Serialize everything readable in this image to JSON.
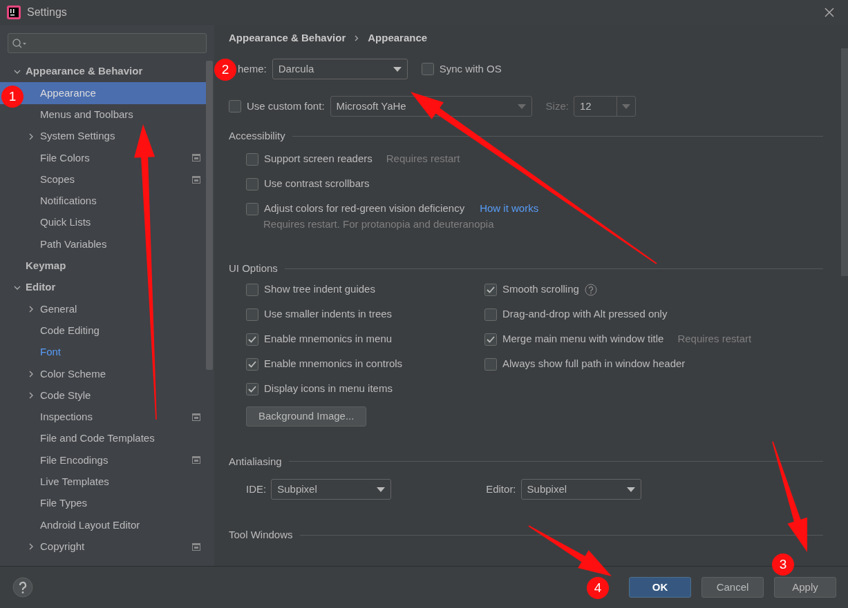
{
  "window": {
    "title": "Settings"
  },
  "sidebar": {
    "items": [
      {
        "label": "Appearance & Behavior",
        "selected": false,
        "expanded": true,
        "children": [
          {
            "label": "Appearance",
            "selected": true,
            "modified": false,
            "project_icon": false
          },
          {
            "label": "Menus and Toolbars",
            "selected": false,
            "modified": false,
            "project_icon": false
          },
          {
            "label": "System Settings",
            "selected": false,
            "modified": false,
            "project_icon": false,
            "expanded": false
          },
          {
            "label": "File Colors",
            "selected": false,
            "modified": false,
            "project_icon": true
          },
          {
            "label": "Scopes",
            "selected": false,
            "modified": false,
            "project_icon": true
          },
          {
            "label": "Notifications",
            "selected": false,
            "modified": false,
            "project_icon": false
          },
          {
            "label": "Quick Lists",
            "selected": false,
            "modified": false,
            "project_icon": false
          },
          {
            "label": "Path Variables",
            "selected": false,
            "modified": false,
            "project_icon": false
          }
        ]
      },
      {
        "label": "Keymap",
        "selected": false
      },
      {
        "label": "Editor",
        "selected": false,
        "expanded": true,
        "children": [
          {
            "label": "General",
            "selected": false,
            "modified": false,
            "project_icon": false,
            "expanded": false
          },
          {
            "label": "Code Editing",
            "selected": false,
            "modified": false,
            "project_icon": false
          },
          {
            "label": "Font",
            "selected": false,
            "modified": true,
            "project_icon": false
          },
          {
            "label": "Color Scheme",
            "selected": false,
            "modified": false,
            "project_icon": false,
            "expanded": false
          },
          {
            "label": "Code Style",
            "selected": false,
            "modified": false,
            "project_icon": false,
            "expanded": false
          },
          {
            "label": "Inspections",
            "selected": false,
            "modified": false,
            "project_icon": true
          },
          {
            "label": "File and Code Templates",
            "selected": false,
            "modified": false,
            "project_icon": false
          },
          {
            "label": "File Encodings",
            "selected": false,
            "modified": false,
            "project_icon": true
          },
          {
            "label": "Live Templates",
            "selected": false,
            "modified": false,
            "project_icon": false
          },
          {
            "label": "File Types",
            "selected": false,
            "modified": false,
            "project_icon": false
          },
          {
            "label": "Android Layout Editor",
            "selected": false,
            "modified": false,
            "project_icon": false
          },
          {
            "label": "Copyright",
            "selected": false,
            "modified": false,
            "project_icon": true,
            "expanded": false
          }
        ]
      }
    ]
  },
  "breadcrumb": [
    "Appearance & Behavior",
    "Appearance"
  ],
  "theme": {
    "label": "heme:",
    "value": "Darcula"
  },
  "sync_with_os": {
    "label": "Sync with OS",
    "checked": false
  },
  "custom_font": {
    "label": "Use custom font:",
    "checked": false,
    "value": "Microsoft YaHe",
    "size_label": "Size:",
    "size_value": "12"
  },
  "accessibility": {
    "title": "Accessibility",
    "options": [
      {
        "label": "Support screen readers",
        "checked": false,
        "note": "Requires restart"
      },
      {
        "label": "Use contrast scrollbars",
        "checked": false
      },
      {
        "label": "Adjust colors for red-green vision deficiency",
        "checked": false,
        "link": "How it works",
        "hint": "Requires restart. For protanopia and deuteranopia"
      }
    ]
  },
  "ui_options": {
    "title": "UI Options",
    "left": [
      {
        "label": "Show tree indent guides",
        "checked": false
      },
      {
        "label": "Use smaller indents in trees",
        "checked": false
      },
      {
        "label": "Enable mnemonics in menu",
        "checked": true
      },
      {
        "label": "Enable mnemonics in controls",
        "checked": true
      },
      {
        "label": "Display icons in menu items",
        "checked": true
      }
    ],
    "right": [
      {
        "label": "Smooth scrolling",
        "checked": true,
        "help": true
      },
      {
        "label": "Drag-and-drop with Alt pressed only",
        "checked": false
      },
      {
        "label": "Merge main menu with window title",
        "checked": true,
        "note": "Requires restart"
      },
      {
        "label": "Always show full path in window header",
        "checked": false
      }
    ],
    "button": "Background Image..."
  },
  "antialiasing": {
    "title": "Antialiasing",
    "ide_label": "IDE:",
    "ide_value": "Subpixel",
    "editor_label": "Editor:",
    "editor_value": "Subpixel"
  },
  "tool_windows": {
    "title": "Tool Windows"
  },
  "footer": {
    "buttons": [
      {
        "label": "OK",
        "default": true
      },
      {
        "label": "Cancel",
        "default": false
      },
      {
        "label": "Apply",
        "default": false
      }
    ]
  },
  "annotations": [
    {
      "label": "1"
    },
    {
      "label": "2"
    },
    {
      "label": "3"
    },
    {
      "label": "4"
    }
  ]
}
